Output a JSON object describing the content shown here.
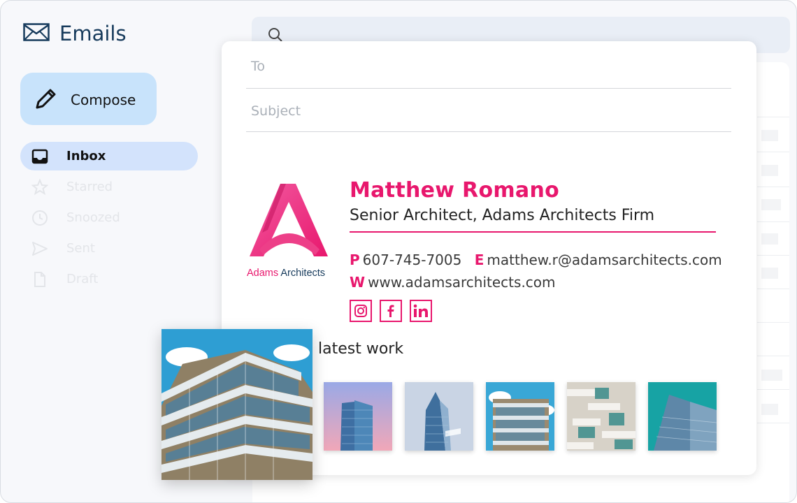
{
  "app": {
    "title": "Emails"
  },
  "sidebar": {
    "compose_label": "Compose",
    "items": [
      {
        "label": "Inbox",
        "icon": "inbox-icon",
        "active": true
      },
      {
        "label": "Starred",
        "icon": "star-icon",
        "active": false
      },
      {
        "label": "Snoozed",
        "icon": "clock-icon",
        "active": false
      },
      {
        "label": "Sent",
        "icon": "send-icon",
        "active": false
      },
      {
        "label": "Draft",
        "icon": "file-icon",
        "active": false
      }
    ]
  },
  "search": {
    "icon": "search-icon"
  },
  "compose": {
    "to_placeholder": "To",
    "subject_placeholder": "Subject"
  },
  "signature": {
    "logo_word1": "Adams",
    "logo_word2": "Architects",
    "name": "Matthew Romano",
    "title": "Senior Architect, Adams Architects Firm",
    "phone_key": "P",
    "phone": "607-745-7005",
    "email_key": "E",
    "email": "matthew.r@adamsarchitects.com",
    "web_key": "W",
    "web": "www.adamsarchitects.com",
    "social": [
      "instagram-icon",
      "facebook-icon",
      "linkedin-icon"
    ],
    "latest_work_label": "latest work"
  },
  "colors": {
    "accent": "#e8176d",
    "brand_dark": "#173b5c",
    "compose_bg": "#c8e3fb",
    "active_nav": "#d3e3fc"
  }
}
